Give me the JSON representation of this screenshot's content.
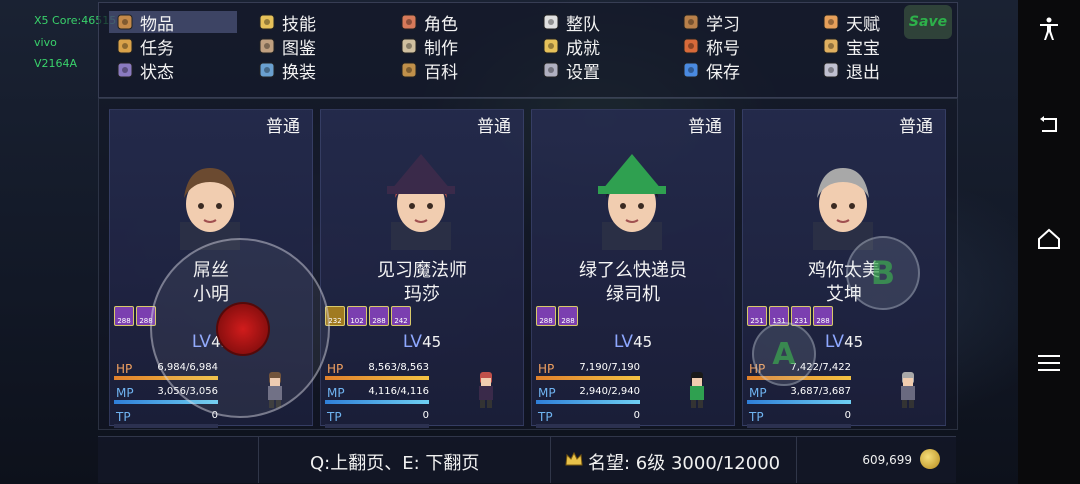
{
  "debug": {
    "line1": "X5 Core:46515",
    "line2": "vivo",
    "line3": "V2164A"
  },
  "menu": {
    "items": [
      {
        "label": "物品",
        "icon": "bag-icon"
      },
      {
        "label": "技能",
        "icon": "skill-icon"
      },
      {
        "label": "角色",
        "icon": "masks-icon"
      },
      {
        "label": "整队",
        "icon": "flag-icon"
      },
      {
        "label": "学习",
        "icon": "book-icon"
      },
      {
        "label": "天赋",
        "icon": "talent-icon"
      },
      {
        "label": "任务",
        "icon": "quest-icon"
      },
      {
        "label": "图鉴",
        "icon": "bestiary-icon"
      },
      {
        "label": "制作",
        "icon": "anvil-icon"
      },
      {
        "label": "成就",
        "icon": "trophy-icon"
      },
      {
        "label": "称号",
        "icon": "medal-icon"
      },
      {
        "label": "宝宝",
        "icon": "pet-icon"
      },
      {
        "label": "状态",
        "icon": "status-icon"
      },
      {
        "label": "换装",
        "icon": "outfit-icon"
      },
      {
        "label": "百科",
        "icon": "encyclopedia-icon"
      },
      {
        "label": "设置",
        "icon": "gear-icon"
      },
      {
        "label": "保存",
        "icon": "floppy-icon"
      },
      {
        "label": "退出",
        "icon": "exit-icon"
      }
    ],
    "save_badge": "Save"
  },
  "party": [
    {
      "mode": "普通",
      "title": "屌丝",
      "name": "小明",
      "level": "45",
      "hp": "6,984/6,984",
      "mp": "3,056/3,056",
      "tp": "0",
      "hp_frac": 1.0,
      "mp_frac": 1.0,
      "tp_frac": 0,
      "states": [
        "288",
        "288"
      ]
    },
    {
      "mode": "普通",
      "title": "见习魔法师",
      "name": "玛莎",
      "level": "45",
      "hp": "8,563/8,563",
      "mp": "4,116/4,116",
      "tp": "0",
      "hp_frac": 1.0,
      "mp_frac": 1.0,
      "tp_frac": 0,
      "states": [
        "232",
        "102",
        "288",
        "242"
      ]
    },
    {
      "mode": "普通",
      "title": "绿了么快递员",
      "name": "绿司机",
      "level": "45",
      "hp": "7,190/7,190",
      "mp": "2,940/2,940",
      "tp": "0",
      "hp_frac": 1.0,
      "mp_frac": 1.0,
      "tp_frac": 0,
      "states": [
        "288",
        "288"
      ]
    },
    {
      "mode": "普通",
      "title": "鸡你太美",
      "name": "艾坤",
      "level": "45",
      "hp": "7,422/7,422",
      "mp": "3,687/3,687",
      "tp": "0",
      "hp_frac": 1.0,
      "mp_frac": 1.0,
      "tp_frac": 0,
      "states": [
        "251",
        "131",
        "231",
        "288"
      ]
    }
  ],
  "labels": {
    "lv": "LV",
    "hp": "HP",
    "mp": "MP",
    "tp": "TP"
  },
  "footer": {
    "page_hint": "Q:上翻页、E: 下翻页",
    "fame": "名望: 6级  3000/12000",
    "gold": "609,699"
  },
  "controls": {
    "a_label": "A",
    "b_label": "B"
  },
  "colors": {
    "hp": "#e0802c",
    "mp": "#2f7fd8",
    "state_bg": "#7b3fb0"
  }
}
